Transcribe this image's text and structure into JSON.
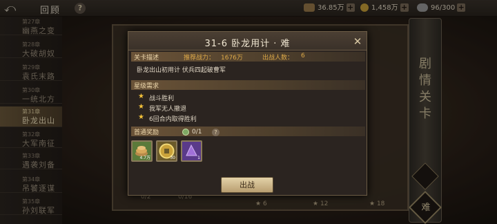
{
  "topbar": {
    "back_icon": "back-arrow-icon",
    "title": "回顾",
    "help": "?",
    "resources": [
      {
        "icon": "chest-icon",
        "value": "36.85万"
      },
      {
        "icon": "coin-icon",
        "value": "1,458万"
      },
      {
        "icon": "stamina-icon",
        "value": "96/300"
      }
    ]
  },
  "sidebar": {
    "chapters": [
      {
        "no": "第27章",
        "name": "幽燕之变"
      },
      {
        "no": "第28章",
        "name": "大破胡奴"
      },
      {
        "no": "第29章",
        "name": "袁氏末路"
      },
      {
        "no": "第30章",
        "name": "一统北方"
      },
      {
        "no": "第31章",
        "name": "卧龙出山"
      },
      {
        "no": "第32章",
        "name": "大军南征"
      },
      {
        "no": "第33章",
        "name": "遇袭刘备"
      },
      {
        "no": "第34章",
        "name": "吊饕逐谋"
      },
      {
        "no": "第35章",
        "name": "孙刘联军"
      }
    ]
  },
  "background": {
    "stats": [
      "0/2",
      "0/16",
      "6",
      "12",
      "18"
    ]
  },
  "scroll": {
    "text": "剧情关卡",
    "mode": "难"
  },
  "modal": {
    "title": "31-6 卧龙用计 · 难",
    "close": "✕",
    "section_desc": "关卡描述",
    "power_label": "推荐战力：",
    "power_value": "1676万",
    "heroes_label": "出战人数：",
    "heroes_value": "6",
    "description": "卧龙出山初用计 伏兵四起破曹军",
    "section_star": "星级需求",
    "conditions": [
      "战斗胜利",
      "我军无人撤退",
      "6回合内取得胜利"
    ],
    "section_reward": "首通奖励",
    "reward_count": "0/1",
    "reward_help": "?",
    "rewards": [
      {
        "icon": "coins-pile-icon",
        "count": "4.7万",
        "color": "#5b7a3a"
      },
      {
        "icon": "gold-coin-icon",
        "count": "30",
        "color": "#6a5a2a"
      },
      {
        "icon": "purple-scroll-icon",
        "count": "1",
        "color": "#5a3a8a"
      }
    ],
    "fight_button": "出战"
  }
}
